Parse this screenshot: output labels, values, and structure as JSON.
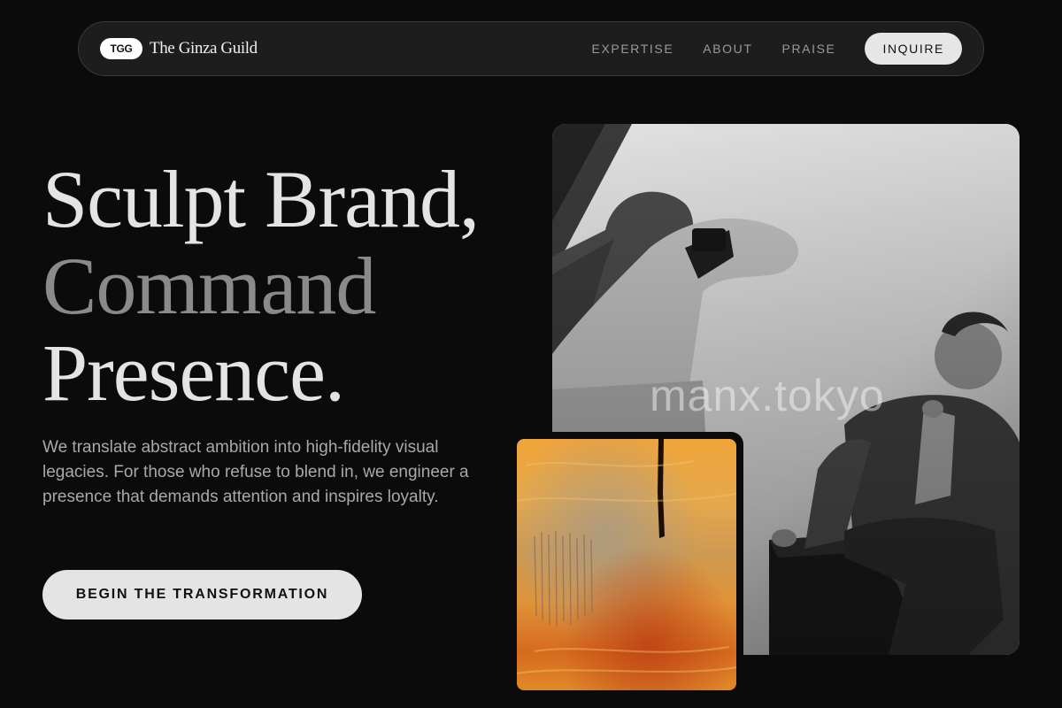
{
  "nav": {
    "badge": "TGG",
    "brand_name": "The Ginza Guild",
    "links": [
      "EXPERTISE",
      "ABOUT",
      "PRAISE"
    ],
    "cta": "INQUIRE"
  },
  "hero": {
    "headline_line1": "Sculpt Brand,",
    "headline_line2": "Command",
    "headline_line3": "Presence.",
    "lead": "We translate abstract ambition into high-fidelity visual legacies. For those who refuse to blend in, we engineer a presence that demands attention and inspires loyalty.",
    "cta": "BEGIN THE TRANSFORMATION"
  },
  "images": {
    "main_watermark": "manx.tokyo"
  },
  "colors": {
    "background": "#0b0b0b",
    "nav_bg": "#1d1d1d",
    "accent_light": "#e4e4e4",
    "muted_headline": "#8a8a8a",
    "body_text": "#a9a9a9"
  }
}
